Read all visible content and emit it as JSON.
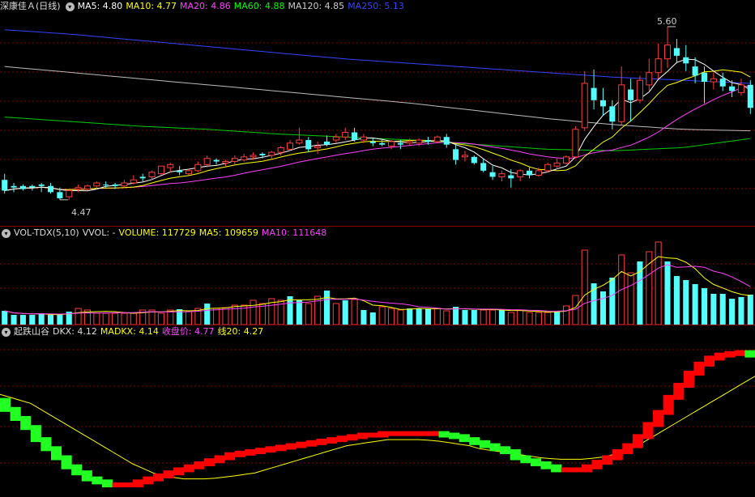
{
  "price_panel": {
    "stock_name": "深康佳Ａ",
    "period": "(日线)",
    "indicators": [
      {
        "label": "MA5: 4.80",
        "color": "#ffffff"
      },
      {
        "label": "MA10: 4.77",
        "color": "#ffff00"
      },
      {
        "label": "MA20: 4.86",
        "color": "#ff40ff"
      },
      {
        "label": "MA60: 4.88",
        "color": "#00ff00"
      },
      {
        "label": "MA120: 4.85",
        "color": "#cccccc"
      },
      {
        "label": "MA250: 5.13",
        "color": "#3344ff"
      }
    ],
    "high_label": "5.60",
    "low_label": "4.47"
  },
  "volume_panel": {
    "indicator_name": "VOL-TDX(5,10)",
    "vvol_label": "VVOL: -",
    "volume_label": "VOLUME: 117729",
    "ma5_label": "MA5: 109659",
    "ma10_label": "MA10: 111648"
  },
  "dkx_panel": {
    "indicator_name": "起跌山谷",
    "dkx_label": "DKX: 4.12",
    "madkx_label": "MADKX: 4.14",
    "close_label": "收盘价: 4.77",
    "line20_label": "线20: 4.27"
  },
  "colors": {
    "up": "#ff3c3c",
    "down": "#54ffff",
    "grid": "#8a0000",
    "dkx_up": "#ff0000",
    "dkx_down": "#22ff22"
  },
  "chart_data": {
    "type": "candlestick",
    "price_range": [
      4.3,
      5.7
    ],
    "candles": [
      [
        4.6,
        4.64,
        4.53,
        4.51,
        0
      ],
      [
        4.56,
        4.58,
        4.55,
        4.52,
        0
      ],
      [
        4.54,
        4.57,
        4.56,
        4.53,
        0
      ],
      [
        4.56,
        4.57,
        4.55,
        4.53,
        0
      ],
      [
        4.56,
        4.58,
        4.57,
        4.52,
        0
      ],
      [
        4.56,
        4.58,
        4.52,
        4.51,
        0
      ],
      [
        4.52,
        4.55,
        4.48,
        4.47,
        0
      ],
      [
        4.49,
        4.51,
        4.53,
        4.47,
        1
      ],
      [
        4.54,
        4.57,
        4.55,
        4.52,
        1
      ],
      [
        4.54,
        4.57,
        4.56,
        4.53,
        1
      ],
      [
        4.56,
        4.59,
        4.58,
        4.54,
        1
      ],
      [
        4.57,
        4.59,
        4.57,
        4.55,
        0
      ],
      [
        4.57,
        4.58,
        4.56,
        4.54,
        0
      ],
      [
        4.56,
        4.6,
        4.58,
        4.55,
        1
      ],
      [
        4.58,
        4.63,
        4.6,
        4.57,
        1
      ],
      [
        4.61,
        4.64,
        4.62,
        4.59,
        0
      ],
      [
        4.62,
        4.66,
        4.65,
        4.6,
        1
      ],
      [
        4.64,
        4.69,
        4.69,
        4.63,
        1
      ],
      [
        4.68,
        4.71,
        4.7,
        4.65,
        1
      ],
      [
        4.66,
        4.69,
        4.65,
        4.63,
        0
      ],
      [
        4.64,
        4.67,
        4.66,
        4.63,
        1
      ],
      [
        4.66,
        4.72,
        4.7,
        4.65,
        1
      ],
      [
        4.7,
        4.76,
        4.74,
        4.68,
        1
      ],
      [
        4.73,
        4.74,
        4.72,
        4.7,
        0
      ],
      [
        4.71,
        4.73,
        4.72,
        4.69,
        1
      ],
      [
        4.72,
        4.76,
        4.74,
        4.7,
        1
      ],
      [
        4.73,
        4.77,
        4.75,
        4.72,
        1
      ],
      [
        4.75,
        4.78,
        4.76,
        4.73,
        1
      ],
      [
        4.76,
        4.78,
        4.77,
        4.74,
        0
      ],
      [
        4.76,
        4.79,
        4.78,
        4.74,
        1
      ],
      [
        4.78,
        4.82,
        4.81,
        4.76,
        1
      ],
      [
        4.8,
        4.86,
        4.84,
        4.79,
        1
      ],
      [
        4.84,
        4.94,
        4.86,
        4.83,
        1
      ],
      [
        4.86,
        4.88,
        4.8,
        4.78,
        0
      ],
      [
        4.81,
        4.85,
        4.82,
        4.77,
        1
      ],
      [
        4.85,
        4.89,
        4.83,
        4.82,
        0
      ],
      [
        4.86,
        4.9,
        4.88,
        4.84,
        1
      ],
      [
        4.88,
        4.94,
        4.91,
        4.86,
        1
      ],
      [
        4.91,
        4.94,
        4.86,
        4.85,
        0
      ],
      [
        4.86,
        4.9,
        4.88,
        4.84,
        1
      ],
      [
        4.85,
        4.87,
        4.84,
        4.82,
        0
      ],
      [
        4.84,
        4.86,
        4.83,
        4.82,
        0
      ],
      [
        4.82,
        4.86,
        4.85,
        4.8,
        1
      ],
      [
        4.83,
        4.86,
        4.84,
        4.8,
        0
      ],
      [
        4.84,
        4.87,
        4.85,
        4.82,
        1
      ],
      [
        4.84,
        4.87,
        4.86,
        4.82,
        1
      ],
      [
        4.86,
        4.88,
        4.85,
        4.83,
        0
      ],
      [
        4.85,
        4.89,
        4.88,
        4.84,
        1
      ],
      [
        4.88,
        4.9,
        4.83,
        4.81,
        0
      ],
      [
        4.8,
        4.83,
        4.73,
        4.7,
        0
      ],
      [
        4.75,
        4.79,
        4.76,
        4.72,
        1
      ],
      [
        4.75,
        4.76,
        4.71,
        4.7,
        0
      ],
      [
        4.71,
        4.74,
        4.66,
        4.65,
        0
      ],
      [
        4.65,
        4.69,
        4.62,
        4.6,
        0
      ],
      [
        4.62,
        4.66,
        4.64,
        4.59,
        1
      ],
      [
        4.63,
        4.67,
        4.61,
        4.55,
        0
      ],
      [
        4.62,
        4.67,
        4.66,
        4.59,
        1
      ],
      [
        4.66,
        4.68,
        4.63,
        4.61,
        0
      ],
      [
        4.63,
        4.68,
        4.66,
        4.62,
        1
      ],
      [
        4.66,
        4.71,
        4.7,
        4.65,
        1
      ],
      [
        4.69,
        4.74,
        4.71,
        4.67,
        1
      ],
      [
        4.71,
        4.76,
        4.75,
        4.7,
        1
      ],
      [
        4.75,
        4.95,
        4.93,
        4.74,
        1
      ],
      [
        4.94,
        5.31,
        5.23,
        4.92,
        1
      ],
      [
        5.2,
        5.32,
        5.12,
        5.06,
        0
      ],
      [
        5.12,
        5.2,
        5.08,
        5.02,
        0
      ],
      [
        5.08,
        5.12,
        4.98,
        4.93,
        0
      ],
      [
        4.98,
        5.34,
        5.22,
        4.96,
        1
      ],
      [
        5.19,
        5.26,
        5.12,
        4.98,
        0
      ],
      [
        5.12,
        5.28,
        5.25,
        5.1,
        1
      ],
      [
        5.22,
        5.39,
        5.3,
        5.18,
        1
      ],
      [
        5.3,
        5.49,
        5.39,
        5.26,
        1
      ],
      [
        5.39,
        5.6,
        5.48,
        5.33,
        1
      ],
      [
        5.46,
        5.52,
        5.41,
        5.36,
        0
      ],
      [
        5.4,
        5.48,
        5.36,
        5.31,
        0
      ],
      [
        5.34,
        5.4,
        5.28,
        5.23,
        0
      ],
      [
        5.3,
        5.34,
        5.24,
        5.1,
        0
      ],
      [
        5.24,
        5.3,
        5.26,
        5.19,
        1
      ],
      [
        5.26,
        5.3,
        5.21,
        5.18,
        0
      ],
      [
        5.21,
        5.25,
        5.18,
        5.14,
        0
      ],
      [
        5.17,
        5.26,
        5.22,
        5.15,
        1
      ],
      [
        5.22,
        5.25,
        5.07,
        5.03,
        0
      ]
    ],
    "volumes": [
      [
        17,
        1
      ],
      [
        12,
        1
      ],
      [
        12,
        1
      ],
      [
        12,
        1
      ],
      [
        14,
        1
      ],
      [
        12,
        1
      ],
      [
        12,
        1
      ],
      [
        16,
        1
      ],
      [
        20,
        0
      ],
      [
        18,
        0
      ],
      [
        14,
        0
      ],
      [
        14,
        0
      ],
      [
        14,
        0
      ],
      [
        14,
        0
      ],
      [
        14,
        0
      ],
      [
        18,
        0
      ],
      [
        18,
        0
      ],
      [
        14,
        0
      ],
      [
        18,
        0
      ],
      [
        19,
        1
      ],
      [
        16,
        0
      ],
      [
        20,
        0
      ],
      [
        26,
        1
      ],
      [
        20,
        0
      ],
      [
        21,
        0
      ],
      [
        24,
        0
      ],
      [
        24,
        0
      ],
      [
        30,
        0
      ],
      [
        26,
        0
      ],
      [
        32,
        0
      ],
      [
        30,
        0
      ],
      [
        35,
        1
      ],
      [
        30,
        1
      ],
      [
        26,
        0
      ],
      [
        35,
        0
      ],
      [
        42,
        1
      ],
      [
        26,
        0
      ],
      [
        30,
        1
      ],
      [
        31,
        0
      ],
      [
        18,
        1
      ],
      [
        15,
        1
      ],
      [
        22,
        0
      ],
      [
        20,
        0
      ],
      [
        18,
        0
      ],
      [
        20,
        1
      ],
      [
        20,
        1
      ],
      [
        20,
        1
      ],
      [
        20,
        0
      ],
      [
        17,
        0
      ],
      [
        22,
        1
      ],
      [
        18,
        1
      ],
      [
        18,
        1
      ],
      [
        18,
        0
      ],
      [
        18,
        0
      ],
      [
        18,
        1
      ],
      [
        15,
        0
      ],
      [
        18,
        0
      ],
      [
        15,
        0
      ],
      [
        15,
        0
      ],
      [
        15,
        0
      ],
      [
        16,
        1
      ],
      [
        23,
        0
      ],
      [
        36,
        0
      ],
      [
        92,
        0
      ],
      [
        51,
        1
      ],
      [
        41,
        1
      ],
      [
        58,
        1
      ],
      [
        86,
        0
      ],
      [
        64,
        0
      ],
      [
        78,
        1
      ],
      [
        90,
        0
      ],
      [
        102,
        0
      ],
      [
        78,
        1
      ],
      [
        60,
        1
      ],
      [
        55,
        1
      ],
      [
        50,
        1
      ],
      [
        45,
        1
      ],
      [
        38,
        1
      ],
      [
        38,
        1
      ],
      [
        32,
        1
      ],
      [
        34,
        1
      ],
      [
        37,
        1
      ]
    ],
    "dkx": [
      4.95,
      4.92,
      4.89,
      4.86,
      4.82,
      4.79,
      4.76,
      4.73,
      4.71,
      4.69,
      4.68,
      4.67,
      4.67,
      4.67,
      4.68,
      4.69,
      4.7,
      4.71,
      4.72,
      4.73,
      4.74,
      4.75,
      4.76,
      4.77,
      4.775,
      4.78,
      4.785,
      4.79,
      4.795,
      4.8,
      4.805,
      4.81,
      4.815,
      4.82,
      4.825,
      4.83,
      4.835,
      4.835,
      4.84,
      4.84,
      4.84,
      4.84,
      4.84,
      4.84,
      4.835,
      4.83,
      4.82,
      4.81,
      4.8,
      4.79,
      4.78,
      4.76,
      4.75,
      4.74,
      4.73,
      4.72,
      4.72,
      4.72,
      4.73,
      4.745,
      4.76,
      4.78,
      4.8,
      4.83,
      4.87,
      4.91,
      4.96,
      5.0,
      5.04,
      5.07,
      5.09,
      5.1,
      5.105,
      5.108,
      5.1
    ],
    "madkx": [
      4.97,
      4.96,
      4.95,
      4.94,
      4.92,
      4.9,
      4.88,
      4.86,
      4.84,
      4.82,
      4.8,
      4.78,
      4.76,
      4.74,
      4.725,
      4.71,
      4.7,
      4.695,
      4.69,
      4.69,
      4.69,
      4.692,
      4.696,
      4.7,
      4.705,
      4.71,
      4.72,
      4.73,
      4.74,
      4.75,
      4.76,
      4.77,
      4.78,
      4.79,
      4.8,
      4.805,
      4.81,
      4.815,
      4.82,
      4.82,
      4.82,
      4.82,
      4.818,
      4.815,
      4.81,
      4.805,
      4.8,
      4.79,
      4.785,
      4.78,
      4.775,
      4.77,
      4.765,
      4.76,
      4.757,
      4.755,
      4.755,
      4.755,
      4.758,
      4.762,
      4.77,
      4.78,
      4.795,
      4.81,
      4.83,
      4.85,
      4.87,
      4.89,
      4.91,
      4.93,
      4.95,
      4.97,
      4.99,
      5.01,
      5.03
    ]
  }
}
